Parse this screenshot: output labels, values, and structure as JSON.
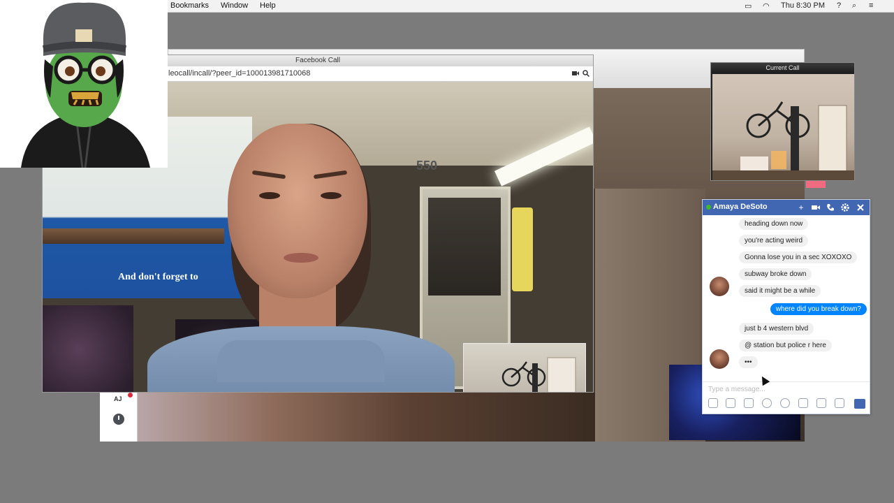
{
  "menubar": {
    "items": [
      "Bookmarks",
      "Window",
      "Help"
    ],
    "clock": "Thu 8:30 PM",
    "help_mark": "?"
  },
  "fb_call": {
    "title": "Facebook Call",
    "url": "leocall/incall/?peer_id=100013981710068",
    "train_number": "550",
    "poster_text": "And don't forget to"
  },
  "current_call": {
    "title": "Current Call"
  },
  "dock": {
    "initials": "AJ"
  },
  "chat": {
    "contact": "Amaya DeSoto",
    "messages": [
      {
        "dir": "in",
        "text": "heading down now"
      },
      {
        "dir": "in",
        "text": "you're acting weird"
      },
      {
        "dir": "in",
        "text": "Gonna lose you in a sec XOXOXO"
      },
      {
        "dir": "in",
        "text": "subway broke down"
      },
      {
        "dir": "in",
        "text": "said it might be a while"
      },
      {
        "dir": "out",
        "text": "where did you break down?"
      },
      {
        "dir": "in",
        "text": "just b 4 western blvd"
      },
      {
        "dir": "in",
        "text": "@ station but police r here"
      },
      {
        "dir": "in",
        "text": "•••"
      }
    ],
    "placeholder": "Type a message...",
    "accent": "#4267b2"
  },
  "icons": [
    "plus-icon",
    "video-icon",
    "phone-icon",
    "gear-icon",
    "close-icon",
    "like-icon",
    "clock-icon",
    "search-icon",
    "wifi-icon"
  ]
}
